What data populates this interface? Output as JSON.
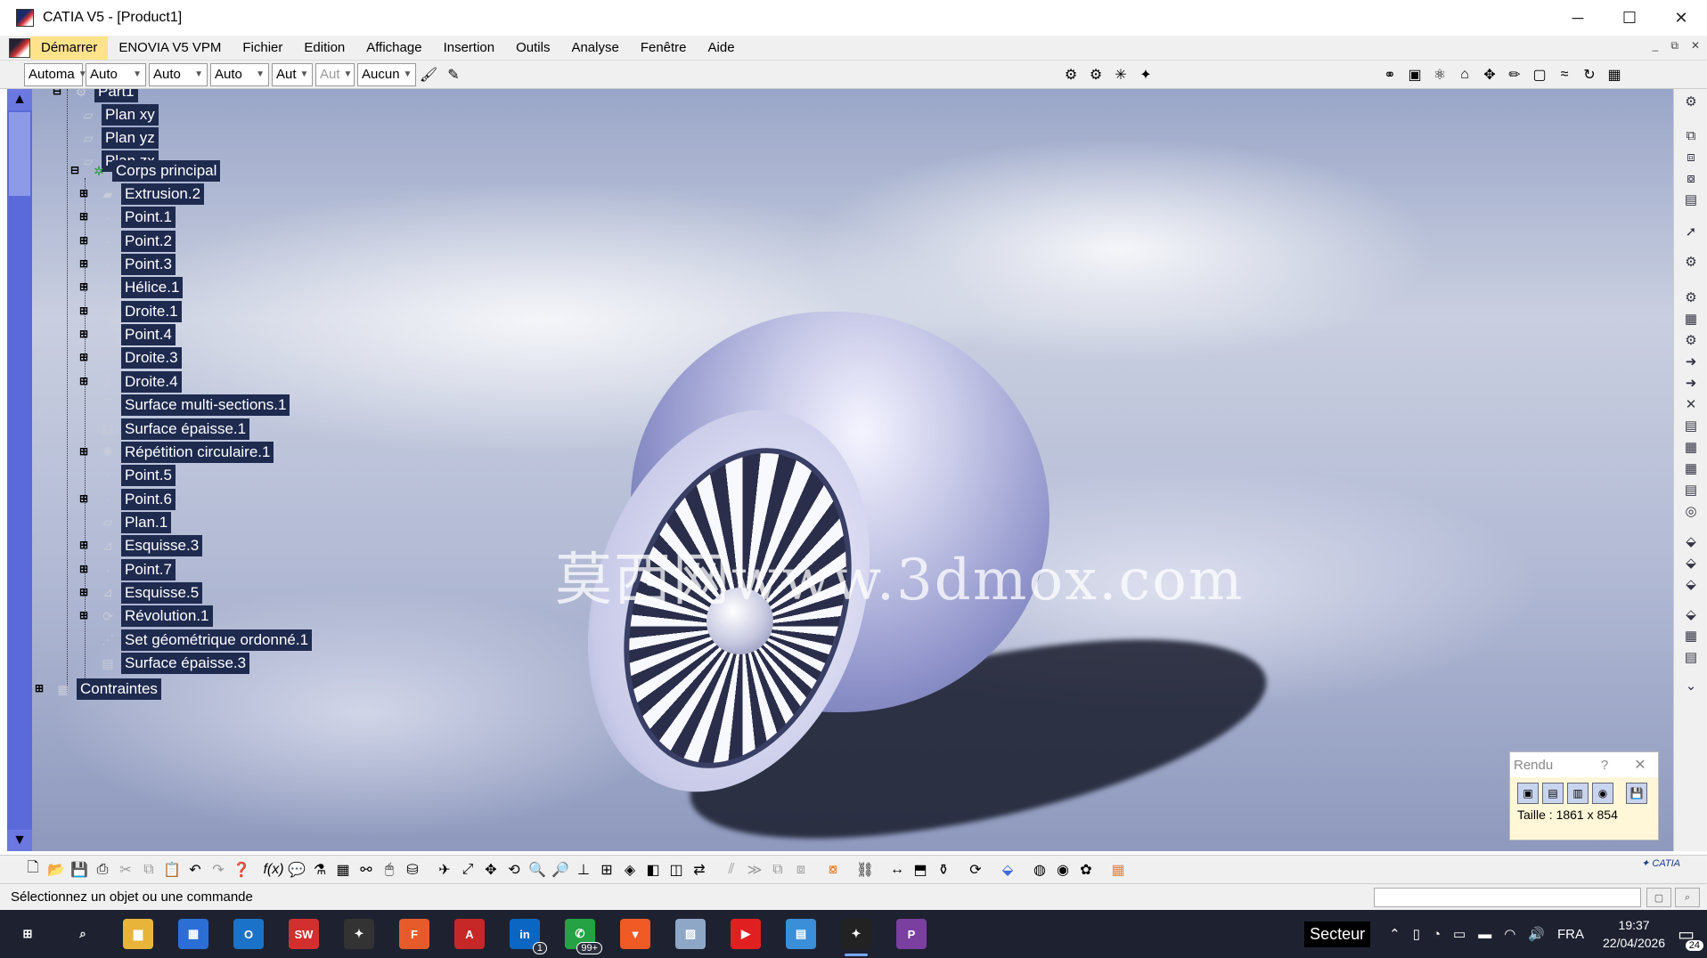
{
  "window": {
    "title": "CATIA V5 - [Product1]",
    "controls": {
      "minimize": "─",
      "maximize": "☐",
      "close": "✕"
    }
  },
  "menu": {
    "items": [
      "Démarrer",
      "ENOVIA V5 VPM",
      "Fichier",
      "Edition",
      "Affichage",
      "Insertion",
      "Outils",
      "Analyse",
      "Fenêtre",
      "Aide"
    ],
    "active": "Démarrer"
  },
  "toolbar_top": {
    "combos": [
      {
        "value": "Automa",
        "disabled": false
      },
      {
        "value": "Auto",
        "disabled": false
      },
      {
        "value": "Auto",
        "disabled": false
      },
      {
        "value": "Auto",
        "disabled": false
      },
      {
        "value": "Aut",
        "disabled": false
      },
      {
        "value": "Aut",
        "disabled": true
      },
      {
        "value": "Aucun",
        "disabled": false
      }
    ]
  },
  "tree": {
    "root": "Part1",
    "planes": [
      "Plan xy",
      "Plan yz",
      "Plan zx"
    ],
    "body": "Corps principal",
    "body_children": [
      {
        "label": "Extrusion.2",
        "icon": "extrusion-icon",
        "expandable": true
      },
      {
        "label": "Point.1",
        "icon": "point-icon",
        "expandable": true
      },
      {
        "label": "Point.2",
        "icon": "point-icon",
        "expandable": true
      },
      {
        "label": "Point.3",
        "icon": "point-icon",
        "expandable": true
      },
      {
        "label": "Hélice.1",
        "icon": "helix-icon",
        "expandable": true
      },
      {
        "label": "Droite.1",
        "icon": "line-icon",
        "expandable": true
      },
      {
        "label": "Point.4",
        "icon": "point-icon",
        "expandable": true
      },
      {
        "label": "Droite.3",
        "icon": "line-icon",
        "expandable": true
      },
      {
        "label": "Droite.4",
        "icon": "line-icon",
        "expandable": true
      },
      {
        "label": "Surface multi-sections.1",
        "icon": "multisection-surface-icon",
        "expandable": false
      },
      {
        "label": "Surface épaisse.1",
        "icon": "thick-surface-icon",
        "expandable": false
      },
      {
        "label": "Répétition circulaire.1",
        "icon": "circular-pattern-icon",
        "expandable": true
      },
      {
        "label": "Point.5",
        "icon": "point-icon",
        "expandable": false
      },
      {
        "label": "Point.6",
        "icon": "point-icon",
        "expandable": true
      },
      {
        "label": "Plan.1",
        "icon": "plane-icon",
        "expandable": false
      },
      {
        "label": "Esquisse.3",
        "icon": "sketch-icon",
        "expandable": true
      },
      {
        "label": "Point.7",
        "icon": "point-icon",
        "expandable": true
      },
      {
        "label": "Esquisse.5",
        "icon": "sketch-icon",
        "expandable": true
      },
      {
        "label": "Révolution.1",
        "icon": "revolution-icon",
        "expandable": true
      },
      {
        "label": "Set géométrique ordonné.1",
        "icon": "ordered-geometric-set-icon",
        "expandable": false
      },
      {
        "label": "Surface épaisse.3",
        "icon": "thick-surface-icon",
        "expandable": false
      }
    ],
    "constraints": "Contraintes"
  },
  "viewport": {
    "watermark": "莫西网www.3dmox.com"
  },
  "rendu_panel": {
    "title": "Rendu",
    "help": "?",
    "close": "✕",
    "size_label": "Taille : 1861 x 854"
  },
  "status": {
    "message": "Sélectionnez un objet ou une commande"
  },
  "taskbar": {
    "apps": [
      {
        "name": "start-icon",
        "label": "⊞",
        "color": "#1e2230"
      },
      {
        "name": "search-icon",
        "label": "⌕",
        "color": "#1e2230"
      },
      {
        "name": "file-explorer-icon",
        "label": "▆",
        "color": "#e8b43a"
      },
      {
        "name": "store-icon",
        "label": "▦",
        "color": "#2b6fd6"
      },
      {
        "name": "outlook-icon",
        "label": "O",
        "color": "#1a73c8"
      },
      {
        "name": "solidworks-icon",
        "label": "SW",
        "color": "#d32f2f"
      },
      {
        "name": "catia-app-icon",
        "label": "✦",
        "color": "#333"
      },
      {
        "name": "fusion-icon",
        "label": "F",
        "color": "#e65b2a"
      },
      {
        "name": "autocad-icon",
        "label": "A",
        "color": "#c62828"
      },
      {
        "name": "linkedin-icon",
        "label": "in",
        "color": "#0a66c2",
        "badge": "1"
      },
      {
        "name": "whatsapp-icon",
        "label": "✆",
        "color": "#25a244",
        "badge": "99+"
      },
      {
        "name": "brave-icon",
        "label": "▼",
        "color": "#f05a24"
      },
      {
        "name": "photos-icon",
        "label": "▨",
        "color": "#8fa7c7"
      },
      {
        "name": "youtube-icon",
        "label": "▶",
        "color": "#e02020"
      },
      {
        "name": "terminal-icon",
        "label": "▤",
        "color": "#3a8fd8"
      },
      {
        "name": "catia-active-icon",
        "label": "✦",
        "color": "#222",
        "active": true
      },
      {
        "name": "pdf-icon",
        "label": "P",
        "color": "#7b3fa0"
      }
    ],
    "secteur": "Secteur",
    "language": "FRA",
    "time": "19:37",
    "date": "22/04/2026",
    "notifications": "24"
  }
}
